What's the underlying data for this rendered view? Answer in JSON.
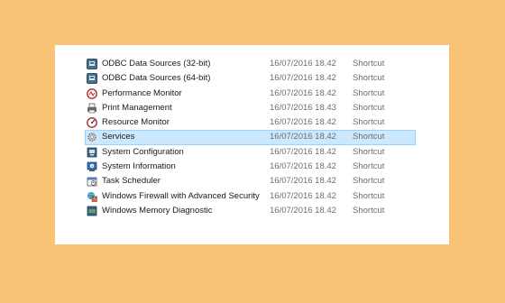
{
  "rows": [
    {
      "name": "ODBC Data Sources (32-bit)",
      "date": "16/07/2016 18.42",
      "type": "Shortcut",
      "icon": "odbc-icon",
      "selected": false
    },
    {
      "name": "ODBC Data Sources (64-bit)",
      "date": "16/07/2016 18.42",
      "type": "Shortcut",
      "icon": "odbc-icon",
      "selected": false
    },
    {
      "name": "Performance Monitor",
      "date": "16/07/2016 18.42",
      "type": "Shortcut",
      "icon": "performance-monitor-icon",
      "selected": false
    },
    {
      "name": "Print Management",
      "date": "16/07/2016 18.43",
      "type": "Shortcut",
      "icon": "printer-icon",
      "selected": false
    },
    {
      "name": "Resource Monitor",
      "date": "16/07/2016 18.42",
      "type": "Shortcut",
      "icon": "resource-monitor-icon",
      "selected": false
    },
    {
      "name": "Services",
      "date": "16/07/2016 18.42",
      "type": "Shortcut",
      "icon": "services-gear-icon",
      "selected": true
    },
    {
      "name": "System Configuration",
      "date": "16/07/2016 18.42",
      "type": "Shortcut",
      "icon": "system-configuration-icon",
      "selected": false
    },
    {
      "name": "System Information",
      "date": "16/07/2016 18.42",
      "type": "Shortcut",
      "icon": "system-information-icon",
      "selected": false
    },
    {
      "name": "Task Scheduler",
      "date": "16/07/2016 18.42",
      "type": "Shortcut",
      "icon": "task-scheduler-icon",
      "selected": false
    },
    {
      "name": "Windows Firewall with Advanced Security",
      "date": "16/07/2016 18.42",
      "type": "Shortcut",
      "icon": "firewall-icon",
      "selected": false
    },
    {
      "name": "Windows Memory Diagnostic",
      "date": "16/07/2016 18.42",
      "type": "Shortcut",
      "icon": "memory-diagnostic-icon",
      "selected": false
    }
  ],
  "colors": {
    "background": "#f8c374",
    "selection": "#cce8ff",
    "selection_border": "#99d1ff"
  }
}
